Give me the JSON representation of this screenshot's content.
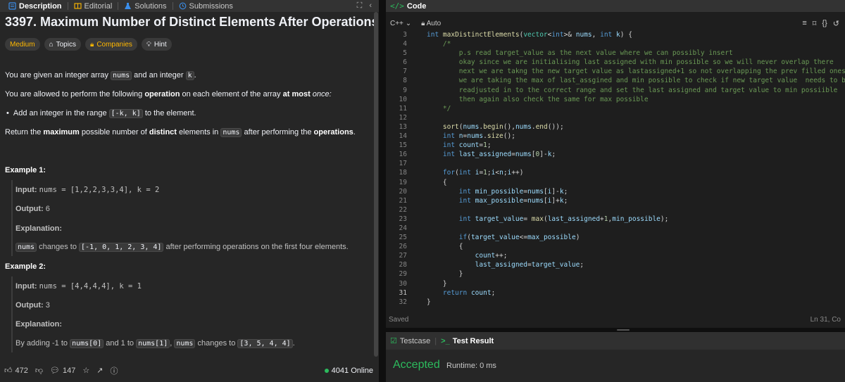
{
  "left_tabs": [
    {
      "label": "Description",
      "icon": "description-icon",
      "active": true
    },
    {
      "label": "Editorial",
      "icon": "book-icon",
      "active": false
    },
    {
      "label": "Solutions",
      "icon": "flask-icon",
      "active": false
    },
    {
      "label": "Submissions",
      "icon": "history-icon",
      "active": false
    }
  ],
  "problem": {
    "title": "3397. Maximum Number of Distinct Elements After Operations",
    "difficulty": "Medium",
    "topics": "Topics",
    "companies": "Companies",
    "hint": "Hint",
    "p1_a": "You are given an integer array ",
    "p1_code1": "nums",
    "p1_b": " and an integer ",
    "p1_code2": "k",
    "p1_c": ".",
    "p2_a": "You are allowed to perform the following ",
    "p2_b": "operation",
    "p2_c": " on each element of the array ",
    "p2_d": "at most",
    "p2_e": " once:",
    "bullet_a": "Add an integer in the range ",
    "bullet_code": "[-k, k]",
    "bullet_b": " to the element.",
    "p3_a": "Return the ",
    "p3_b": "maximum",
    "p3_c": " possible number of ",
    "p3_d": "distinct",
    "p3_e": " elements in ",
    "p3_code": "nums",
    "p3_f": " after performing the ",
    "p3_g": "operations",
    "p3_h": "."
  },
  "example1": {
    "heading": "Example 1:",
    "input_label": "Input:",
    "input_value": "nums = [1,2,2,3,3,4], k = 2",
    "output_label": "Output:",
    "output_value": "6",
    "explanation_label": "Explanation:",
    "exp_code1": "nums",
    "exp_a": " changes to ",
    "exp_code2": "[-1, 0, 1, 2, 3, 4]",
    "exp_b": " after performing operations on the first four elements."
  },
  "example2": {
    "heading": "Example 2:",
    "input_label": "Input:",
    "input_value": "nums = [4,4,4,4], k = 1",
    "output_label": "Output:",
    "output_value": "3",
    "explanation_label": "Explanation:",
    "exp_a": "By adding -1 to ",
    "exp_code1": "nums[0]",
    "exp_b": " and 1 to ",
    "exp_code2": "nums[1]",
    "exp_c": ", ",
    "exp_code3": "nums",
    "exp_d": " changes to ",
    "exp_code4": "[3, 5, 4, 4]",
    "exp_e": "."
  },
  "bottom_bar": {
    "likes": "472",
    "comments": "147",
    "online": "4041 Online"
  },
  "code_panel": {
    "title": "Code",
    "language": "C++",
    "auto": "Auto",
    "saved": "Saved",
    "cursor": "Ln 31, Co"
  },
  "gutter": [
    "3",
    "4",
    "5",
    "6",
    "7",
    "8",
    "9",
    "10",
    "11",
    "12",
    "13",
    "14",
    "15",
    "16",
    "17",
    "18",
    "19",
    "20",
    "21",
    "22",
    "23",
    "24",
    "25",
    "26",
    "27",
    "28",
    "29",
    "30",
    "31",
    "32"
  ],
  "code_lines": [
    "int maxDistinctElements(vector<int>& nums, int k) {",
    "    /*",
    "        p.s read target_value as the next value where we can possibly insert",
    "        okay since we are initialising last assigned with min possible so we will never overlap there",
    "        next we are takng the new target value as lastassigned+1 so not overlapping the prev filled ones",
    "        we are taking the max of last_assgined and min possible to check if new target value  needs to be",
    "        readjusted in to the correct range and set the last assigned and target value to min possiible",
    "        then again also check the same for max possible",
    "    */",
    "",
    "    sort(nums.begin(),nums.end());",
    "    int n=nums.size();",
    "    int count=1;",
    "    int last_assigned=nums[0]-k;",
    "",
    "    for(int i=1;i<n;i++)",
    "    {",
    "        int min_possible=nums[i]-k;",
    "        int max_possible=nums[i]+k;",
    "",
    "        int target_value= max(last_assigned+1,min_possible);",
    "",
    "        if(target_value<=max_possible)",
    "        {",
    "            count++;",
    "            last_assigned=target_value;",
    "        }",
    "    }",
    "    return count;",
    "}"
  ],
  "result": {
    "testcase_tab": "Testcase",
    "testresult_tab": "Test Result",
    "status": "Accepted",
    "runtime": "Runtime: 0 ms"
  }
}
